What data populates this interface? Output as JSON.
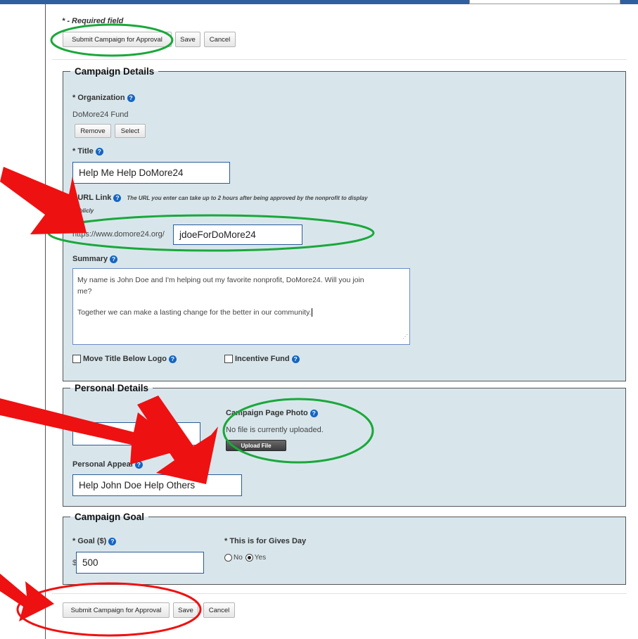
{
  "required_note": "* - Required field",
  "top_actions": {
    "submit": "Submit Campaign for Approval",
    "save": "Save",
    "cancel": "Cancel"
  },
  "campaign_details": {
    "legend": "Campaign Details",
    "organization_label": "* Organization",
    "organization_value": "DoMore24 Fund",
    "remove": "Remove",
    "select": "Select",
    "title_label": "* Title",
    "title_value": "Help Me Help DoMore24",
    "url_label": "* URL Link",
    "url_note": "The URL you enter can take up to 2 hours after being approved by the nonprofit to display",
    "url_note_2": "publicly",
    "url_prefix": "https://www.domore24.org/",
    "url_value": "jdoeForDoMore24",
    "summary_label": "Summary",
    "summary_line1": "My name is John Doe and I'm helping out my favorite nonprofit, DoMore24. Will you join",
    "summary_line2": "me?",
    "summary_line3": "Together we can make a lasting change for the better in our community.",
    "move_title_label": "Move Title Below Logo",
    "incentive_label": "Incentive Fund"
  },
  "personal_details": {
    "legend": "Personal Details",
    "photo_label": "Campaign Page Photo",
    "photo_status": "No file is currently uploaded.",
    "upload_button": "Upload File",
    "appeal_label": "Personal Appeal",
    "appeal_value": "Help John Doe Help Others"
  },
  "campaign_goal": {
    "legend": "Campaign Goal",
    "goal_label": "* Goal ($)",
    "goal_prefix": "$",
    "goal_value": "500",
    "gives_day_label": "* This is for Gives Day",
    "option_no": "No",
    "option_yes": "Yes",
    "selected": "Yes"
  },
  "bottom_actions": {
    "submit": "Submit Campaign for Approval",
    "save": "Save",
    "cancel": "Cancel"
  },
  "colors": {
    "header_bar": "#2f5f9e",
    "panel_bg": "#d8e6ec",
    "input_border": "#2a5b98",
    "help_icon": "#1565c0",
    "annotation_red": "#ee1111",
    "annotation_green": "#1aa83a"
  }
}
